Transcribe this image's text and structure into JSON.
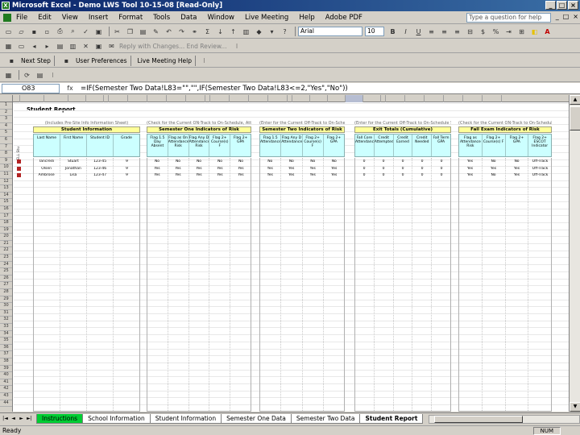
{
  "window": {
    "title": "Microsoft Excel - Demo LWS Tool 10-15-08  [Read-Only]",
    "app_icon": "excel-icon",
    "buttons": {
      "minimize": "_",
      "maximize": "□",
      "close": "×"
    }
  },
  "menu": {
    "items": [
      "File",
      "Edit",
      "View",
      "Insert",
      "Format",
      "Tools",
      "Data",
      "Window",
      "Live Meeting",
      "Help",
      "Adobe PDF"
    ],
    "help_placeholder": "Type a question for help",
    "doc_controls": [
      "_",
      "□",
      "×"
    ]
  },
  "toolbar_standard": {
    "font_name": "Arial",
    "font_size": "10",
    "bold": "B",
    "italic": "I",
    "underline": "U",
    "currency": "$",
    "percent": "%",
    "font_color": "A"
  },
  "toolbar_review": {
    "reply_text": "Reply with Changes...  End Review..."
  },
  "toolbar_custom": {
    "buttons": [
      "Next Step",
      "User Preferences",
      "Live Meeting Help"
    ]
  },
  "formula_bar": {
    "name_box": "O83",
    "fx": "fx",
    "formula": "=IF(Semester Two Data!L83=\"\",\"\",IF(Semester Two Data!L83<=2,\"Yes\",\"No\"))"
  },
  "sheet": {
    "report_title": "Student Report",
    "selected_column_index": 20,
    "row_numbers": [
      "1",
      "2",
      "3",
      "4",
      "5",
      "6",
      "7",
      "8",
      "9",
      "10",
      "11",
      "12",
      "13",
      "14",
      "15",
      "16",
      "17",
      "18",
      "19",
      "20",
      "21",
      "22",
      "23",
      "24",
      "25",
      "26",
      "27",
      "28",
      "29",
      "30",
      "31",
      "32",
      "33",
      "34",
      "35",
      "36",
      "37",
      "38",
      "39",
      "40",
      "41",
      "42",
      "43",
      "44"
    ],
    "sections": [
      {
        "key": "student",
        "caption": "(Includes Pre-Site Info Information Sheet)",
        "header": "Student Information",
        "sidebar": "ELL Stu",
        "columns": [
          "Last Name",
          "First Name",
          "Student ID",
          "Grade"
        ],
        "rows": [
          [
            "Tancredi",
            "Stuart",
            "123-45",
            "9"
          ],
          [
            "Olsen",
            "Jonathan",
            "123-46",
            "9"
          ],
          [
            "Ambrose",
            "Lisa",
            "123-47",
            "9"
          ]
        ]
      },
      {
        "key": "sem1",
        "caption": "(Check for the Current ON-Track to On-Schedule, Attendance)",
        "header": "Semester One Indicators of Risk",
        "columns": [
          "Flag 1.5 Day Absent",
          "Flag as On Attendance Risk",
          "Flag Any D Attendance Risk",
          "Flag 2+ Course(s) F",
          "Flag 2+ GPA"
        ],
        "rows": [
          [
            "No",
            "No",
            "No",
            "No",
            "No"
          ],
          [
            "Yes",
            "Yes",
            "Yes",
            "Yes",
            "Yes"
          ],
          [
            "Yes",
            "Yes",
            "Yes",
            "Yes",
            "Yes"
          ]
        ]
      },
      {
        "key": "sem2",
        "caption": "(Enter for the Current Off-Track to On-Schedule Semester)",
        "header": "Semester Two Indicators of Risk",
        "columns": [
          "Flag 1.5 Attendance",
          "Flag Any D Attendance",
          "Flag 2+ Course(s) F",
          "Flag 2+ GPA"
        ],
        "rows": [
          [
            "No",
            "No",
            "No",
            "No"
          ],
          [
            "Yes",
            "Yes",
            "Yes",
            "Yes"
          ],
          [
            "Yes",
            "Yes",
            "Yes",
            "Yes"
          ]
        ]
      },
      {
        "key": "exit",
        "caption": "(Enter for the Current Off-Track to On-Schedule Semester)",
        "header": "Exit Totals (Cumulative)",
        "columns": [
          "Fall Core Attendance",
          "Credit Attempted",
          "Credit Earned",
          "Credit Needed",
          "Fall Term GPA"
        ],
        "rows": [
          [
            "0",
            "0",
            "0",
            "0",
            "0"
          ],
          [
            "0",
            "0",
            "0",
            "0",
            "0"
          ],
          [
            "0",
            "0",
            "0",
            "0",
            "0"
          ]
        ]
      },
      {
        "key": "fall",
        "caption": "(Check for the Current ON-Track to On-Schedule, Attendance)",
        "header": "Fall Exam Indicators of Risk",
        "columns": [
          "Flag as Attendance Risk",
          "Flag 2+ Course(s) F",
          "Flag 2+ GPA",
          "Flag 2+ ESCOT Indicator"
        ],
        "rows": [
          [
            "Yes",
            "No",
            "No",
            "Off-Track"
          ],
          [
            "Yes",
            "Yes",
            "Yes",
            "Off-Track"
          ],
          [
            "Yes",
            "No",
            "Yes",
            "Off-Track"
          ]
        ]
      }
    ]
  },
  "tabs": {
    "nav": [
      "|◄",
      "◄",
      "►",
      "►|"
    ],
    "items": [
      {
        "label": "Instructions",
        "style": "green"
      },
      {
        "label": "School Information",
        "style": "normal"
      },
      {
        "label": "Student Information",
        "style": "normal"
      },
      {
        "label": "Semester One Data",
        "style": "normal"
      },
      {
        "label": "Semester Two Data",
        "style": "normal"
      },
      {
        "label": "Student Report",
        "style": "active"
      }
    ]
  },
  "status": {
    "left": "Ready",
    "right": "NUM"
  }
}
